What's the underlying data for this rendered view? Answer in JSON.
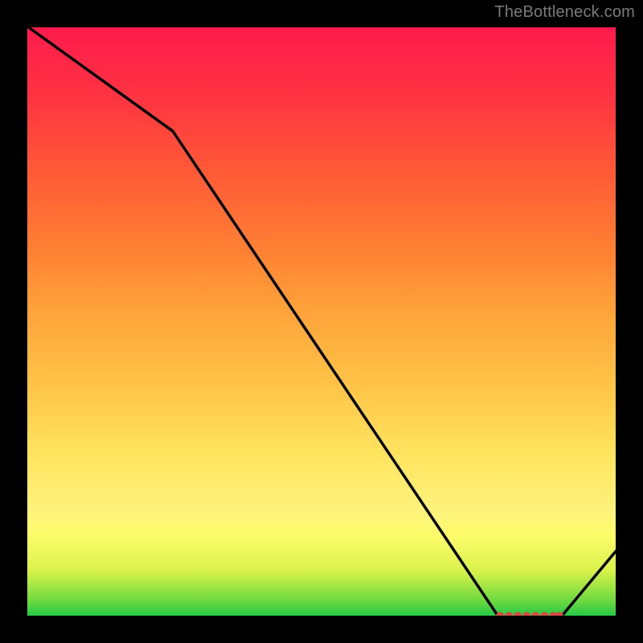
{
  "attribution": "TheBottleneck.com",
  "chart_data": {
    "type": "line",
    "title": "",
    "xlabel": "",
    "ylabel": "",
    "xlim": [
      0,
      100
    ],
    "ylim": [
      0,
      100
    ],
    "grid": false,
    "legend": false,
    "x": [
      0,
      25,
      80,
      90,
      100
    ],
    "values": [
      100,
      82,
      0,
      0,
      12
    ],
    "markers": {
      "x": [
        80,
        81.5,
        83,
        84.5,
        86,
        87.5,
        89,
        90
      ],
      "y": [
        0.5,
        0.5,
        0.5,
        0.5,
        0.5,
        0.5,
        0.5,
        0.5
      ],
      "color": "#d64a3f"
    },
    "line_color": "#000000",
    "background_gradient": [
      "#16c54a",
      "#fdfc6a",
      "#ff1a4d"
    ]
  }
}
